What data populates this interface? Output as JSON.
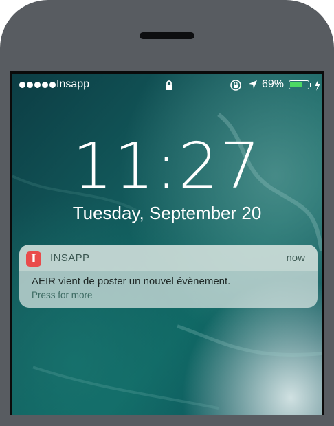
{
  "status_bar": {
    "carrier": "Insapp",
    "battery_percent": "69%",
    "battery_level": 0.69,
    "icons": [
      "signal-dots",
      "lock-icon",
      "rotation-lock-icon",
      "location-arrow-icon",
      "battery-icon",
      "charging-bolt-icon"
    ]
  },
  "lock_screen": {
    "time": "11:27",
    "date": "Tuesday, September 20"
  },
  "notification": {
    "app_icon_letter": "I",
    "app_name": "INSAPP",
    "time": "now",
    "message": "AEIR vient de poster un nouvel évènement.",
    "hint": "Press for more"
  },
  "colors": {
    "device_frame": "#585c61",
    "battery_fill": "#4cd964",
    "app_icon": "#e94b4b"
  }
}
